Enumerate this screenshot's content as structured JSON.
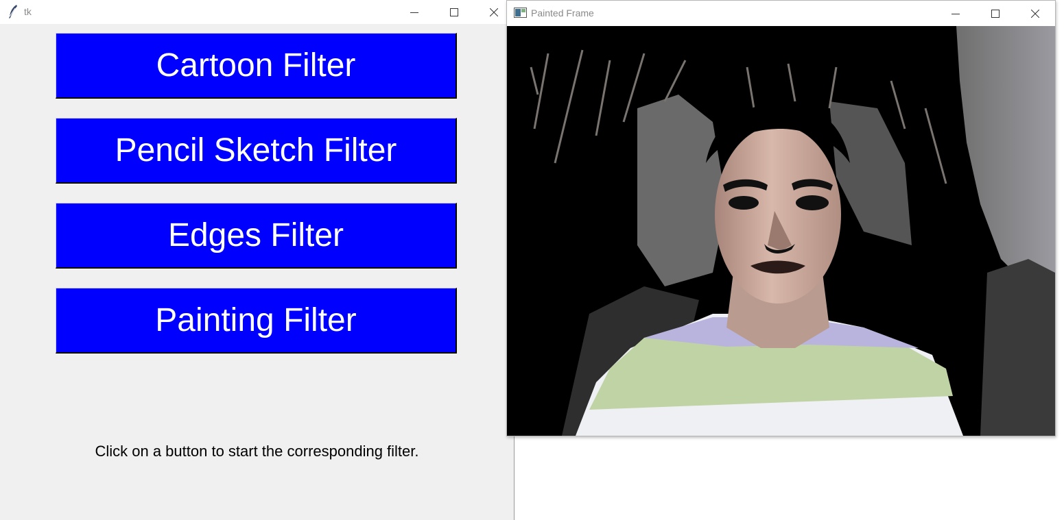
{
  "tk_window": {
    "title": "tk",
    "icon": "feather-icon",
    "buttons": {
      "cartoon": "Cartoon Filter",
      "pencil": "Pencil Sketch Filter",
      "edges": "Edges Filter",
      "painting": "Painting Filter"
    },
    "button_color": "#0000ff",
    "button_text_color": "#ffffff",
    "hint": "Click on a button to start the corresponding filter."
  },
  "cv_window": {
    "title": "Painted Frame",
    "icon": "opencv-window-icon",
    "content": "painted-webcam-frame"
  },
  "window_controls": [
    "minimize-icon",
    "maximize-icon",
    "close-icon"
  ]
}
